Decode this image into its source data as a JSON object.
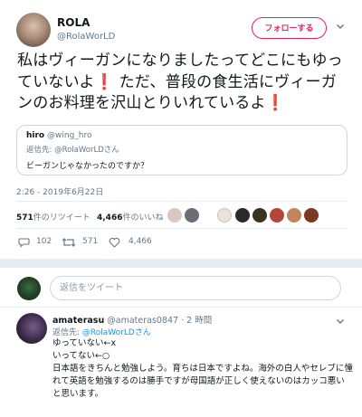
{
  "author": {
    "name": "ROLA",
    "handle": "@RolaWorLD",
    "follow_label": "フォローする"
  },
  "tweet": {
    "text_parts": [
      "私はヴィーガンになりましたってどこにもゆっていないよ",
      "❗",
      " ただ、普段の食生活にヴィーガンのお料理を沢山とりいれているよ",
      "❗"
    ],
    "timestamp": "2:26 - 2019年6月22日"
  },
  "quote": {
    "name": "hiro",
    "handle": "@wing_hro",
    "reply_prefix": "返信先:",
    "reply_to": "@RolaWorLDさん",
    "text": "ビーガンじゃなかったのですか？"
  },
  "stats": {
    "retweets_count": "571",
    "retweets_label": "件のリツイート",
    "likes_count": "4,466",
    "likes_label": "件のいいね"
  },
  "actions": {
    "reply_count": "102",
    "retweet_count": "571",
    "like_count": "4,466"
  },
  "reply_input": {
    "placeholder": "返信をツイート"
  },
  "reply": {
    "name": "amaterasu",
    "handle": "@amateras0847",
    "time": "· 2 時間",
    "reply_prefix": "返信先:",
    "reply_to": "@RolaWorLDさん",
    "text": "ゆっていない←x\nいってない←○\n日本語をきちんと勉強しよう。育ちは日本ですよね。海外の白人やセレブに憧れて英語を勉強するのは勝手ですが母国語が正しく使えないのはカッコ悪いと思います。"
  },
  "colors": {
    "accent": "#1b95e0",
    "follow_red": "#e0245e",
    "muted": "#657786",
    "border": "#e6ecf0"
  }
}
